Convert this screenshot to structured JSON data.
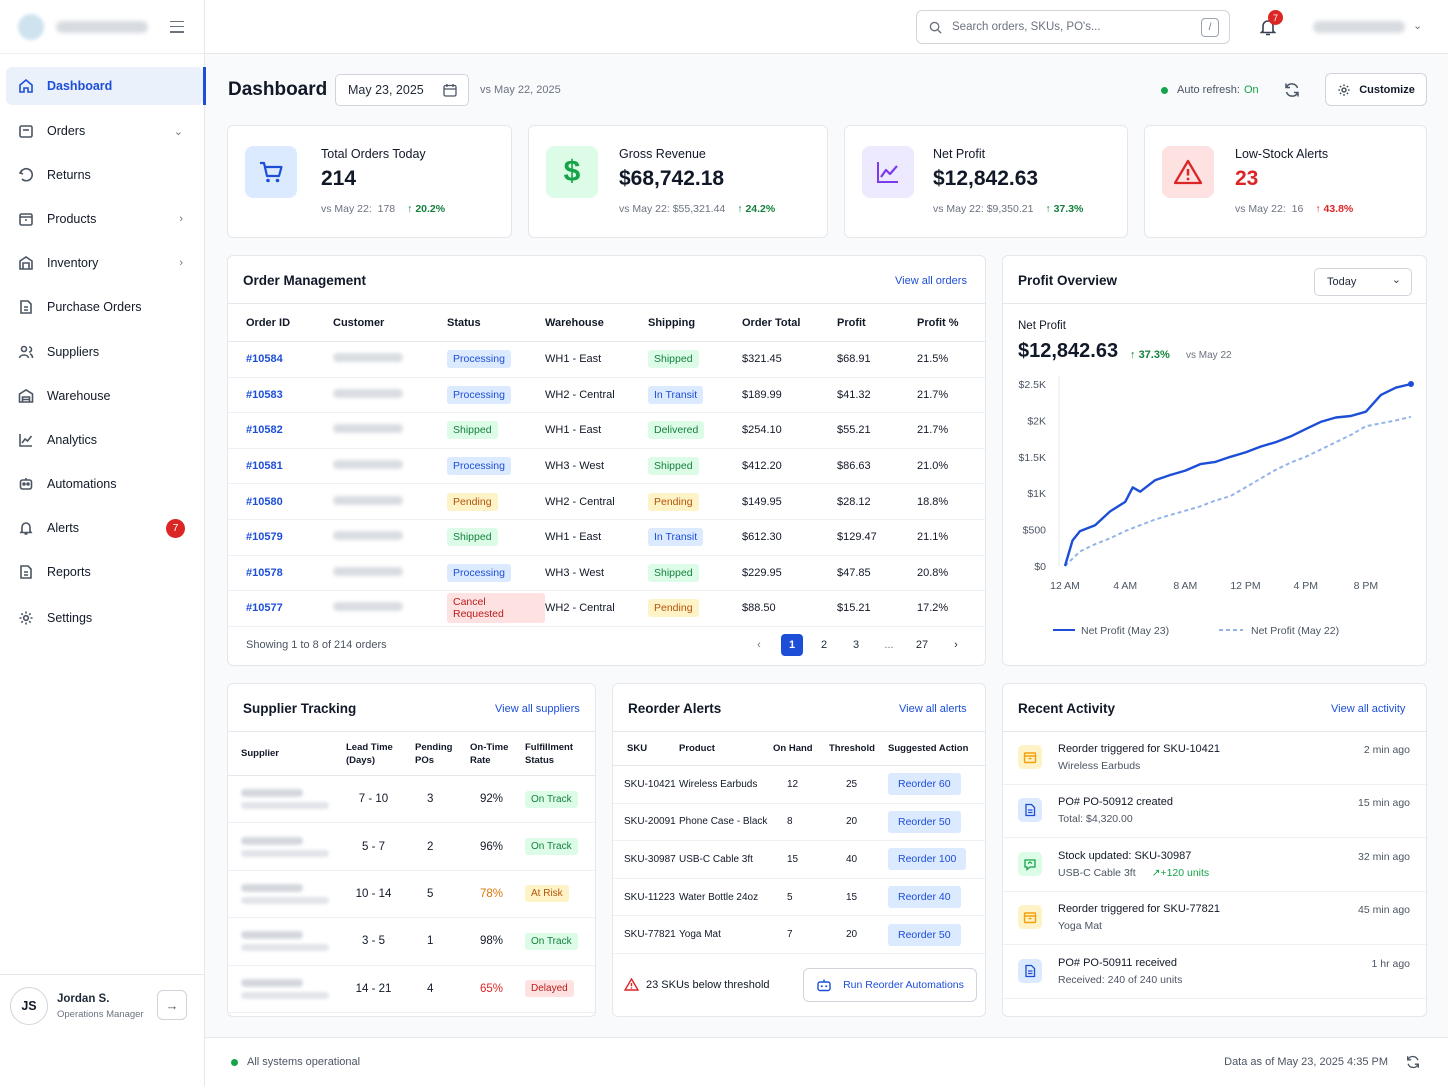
{
  "sidebar": {
    "items": [
      {
        "label": "Dashboard"
      },
      {
        "label": "Orders"
      },
      {
        "label": "Returns"
      },
      {
        "label": "Products"
      },
      {
        "label": "Inventory"
      },
      {
        "label": "Purchase Orders"
      },
      {
        "label": "Suppliers"
      },
      {
        "label": "Warehouse"
      },
      {
        "label": "Analytics"
      },
      {
        "label": "Automations"
      },
      {
        "label": "Alerts",
        "badge": "7"
      },
      {
        "label": "Reports"
      },
      {
        "label": "Settings"
      }
    ],
    "user": {
      "initials": "JS",
      "name": "Jordan S.",
      "role": "Operations Manager"
    }
  },
  "topbar": {
    "search_placeholder": "Search orders, SKUs, PO's...",
    "shortcut": "/",
    "notif_count": "7"
  },
  "header": {
    "title": "Dashboard",
    "date": "May 23, 2025",
    "compare": "vs May 22, 2025",
    "auto_refresh_label": "Auto refresh:",
    "auto_refresh_value": "On",
    "customize": "Customize"
  },
  "kpis": [
    {
      "label": "Total Orders Today",
      "value": "214",
      "prev_label": "vs May 22:",
      "prev": "178",
      "change": "20.2%"
    },
    {
      "label": "Gross Revenue",
      "value": "$68,742.18",
      "prev_label": "vs May 22:",
      "prev": "$55,321.44",
      "change": "24.2%"
    },
    {
      "label": "Net Profit",
      "value": "$12,842.63",
      "prev_label": "vs May 22:",
      "prev": "$9,350.21",
      "change": "37.3%"
    },
    {
      "label": "Low-Stock Alerts",
      "value": "23",
      "prev_label": "vs May 22:",
      "prev": "16",
      "change": "43.8%"
    }
  ],
  "orders": {
    "title": "Order Management",
    "link": "View all orders",
    "columns": [
      "Order ID",
      "Customer",
      "Status",
      "Warehouse",
      "Shipping",
      "Order Total",
      "Profit",
      "Profit %"
    ],
    "rows": [
      {
        "id": "#10584",
        "status": "Processing",
        "wh": "WH1 - East",
        "ship": "Shipped",
        "total": "$321.45",
        "profit": "$68.91",
        "pct": "21.5%"
      },
      {
        "id": "#10583",
        "status": "Processing",
        "wh": "WH2 - Central",
        "ship": "In Transit",
        "total": "$189.99",
        "profit": "$41.32",
        "pct": "21.7%"
      },
      {
        "id": "#10582",
        "status": "Shipped",
        "wh": "WH1 - East",
        "ship": "Delivered",
        "total": "$254.10",
        "profit": "$55.21",
        "pct": "21.7%"
      },
      {
        "id": "#10581",
        "status": "Processing",
        "wh": "WH3 - West",
        "ship": "Shipped",
        "total": "$412.20",
        "profit": "$86.63",
        "pct": "21.0%"
      },
      {
        "id": "#10580",
        "status": "Pending",
        "wh": "WH2 - Central",
        "ship": "Pending",
        "total": "$149.95",
        "profit": "$28.12",
        "pct": "18.8%"
      },
      {
        "id": "#10579",
        "status": "Shipped",
        "wh": "WH1 - East",
        "ship": "In Transit",
        "total": "$612.30",
        "profit": "$129.47",
        "pct": "21.1%"
      },
      {
        "id": "#10578",
        "status": "Processing",
        "wh": "WH3 - West",
        "ship": "Shipped",
        "total": "$229.95",
        "profit": "$47.85",
        "pct": "20.8%"
      },
      {
        "id": "#10577",
        "status": "Cancel Requested",
        "wh": "WH2 - Central",
        "ship": "Pending",
        "total": "$88.50",
        "profit": "$15.21",
        "pct": "17.2%"
      }
    ],
    "showing": "Showing 1 to 8 of 214 orders",
    "pages": [
      "1",
      "2",
      "3",
      "...",
      "27"
    ]
  },
  "profit_overview": {
    "title": "Profit Overview",
    "range": "Today",
    "metric": "Net Profit",
    "value": "$12,842.63",
    "change": "37.3%",
    "compare": "vs May 22"
  },
  "chart_data": {
    "type": "line",
    "x_ticks": [
      "12 AM",
      "4 AM",
      "8 AM",
      "12 PM",
      "4 PM",
      "8 PM"
    ],
    "y_ticks": [
      "$0",
      "$500",
      "$1K",
      "$1.5K",
      "$2K",
      "$2.5K"
    ],
    "ylim": [
      0,
      2500
    ],
    "xlim": [
      0,
      23
    ],
    "grid": false,
    "legend": "bottom",
    "series": [
      {
        "name": "Net Profit (May 23)",
        "color": "#1d4ed8",
        "style": "solid",
        "x": [
          0,
          0.5,
          1,
          2,
          3,
          4,
          4.5,
          5,
          6,
          7,
          8,
          9,
          10,
          11,
          12,
          13,
          14,
          15,
          16,
          17,
          18,
          19,
          20,
          21,
          22,
          23
        ],
        "y": [
          0,
          350,
          480,
          560,
          750,
          880,
          1080,
          1020,
          1180,
          1250,
          1310,
          1400,
          1430,
          1500,
          1560,
          1640,
          1700,
          1780,
          1880,
          1980,
          2040,
          2060,
          2120,
          2350,
          2450,
          2500
        ]
      },
      {
        "name": "Net Profit (May 22)",
        "color": "#93b4ea",
        "style": "dashed",
        "x": [
          0,
          1,
          2,
          3,
          4,
          5,
          6,
          7,
          8,
          9,
          10,
          11,
          12,
          13,
          14,
          15,
          16,
          17,
          18,
          19,
          20,
          21,
          22,
          23
        ],
        "y": [
          0,
          200,
          300,
          380,
          480,
          560,
          640,
          700,
          760,
          820,
          900,
          960,
          1080,
          1200,
          1320,
          1420,
          1500,
          1600,
          1700,
          1800,
          1920,
          1960,
          2000,
          2050
        ]
      }
    ]
  },
  "suppliers": {
    "title": "Supplier Tracking",
    "link": "View all suppliers",
    "columns": [
      "Supplier",
      "Lead Time (Days)",
      "Pending POs",
      "On-Time Rate",
      "Fulfillment Status"
    ],
    "rows": [
      {
        "lead": "7 - 10",
        "pos": "3",
        "rate": "92%",
        "status": "On Track",
        "rate_color": "#111827"
      },
      {
        "lead": "5 - 7",
        "pos": "2",
        "rate": "96%",
        "status": "On Track",
        "rate_color": "#111827"
      },
      {
        "lead": "10 - 14",
        "pos": "5",
        "rate": "78%",
        "status": "At Risk",
        "rate_color": "#d97706"
      },
      {
        "lead": "3 - 5",
        "pos": "1",
        "rate": "98%",
        "status": "On Track",
        "rate_color": "#111827"
      },
      {
        "lead": "14 - 21",
        "pos": "4",
        "rate": "65%",
        "status": "Delayed",
        "rate_color": "#dc2626"
      }
    ]
  },
  "reorder": {
    "title": "Reorder Alerts",
    "link": "View all alerts",
    "columns": [
      "SKU",
      "Product",
      "On Hand",
      "Threshold",
      "Suggested Action"
    ],
    "rows": [
      {
        "sku": "SKU-10421",
        "product": "Wireless Earbuds",
        "on_hand": "12",
        "threshold": "25",
        "action": "Reorder 60"
      },
      {
        "sku": "SKU-20091",
        "product": "Phone Case - Black",
        "on_hand": "8",
        "threshold": "20",
        "action": "Reorder 50"
      },
      {
        "sku": "SKU-30987",
        "product": "USB-C Cable 3ft",
        "on_hand": "15",
        "threshold": "40",
        "action": "Reorder 100"
      },
      {
        "sku": "SKU-11223",
        "product": "Water Bottle 24oz",
        "on_hand": "5",
        "threshold": "15",
        "action": "Reorder 40"
      },
      {
        "sku": "SKU-77821",
        "product": "Yoga Mat",
        "on_hand": "7",
        "threshold": "20",
        "action": "Reorder 50"
      }
    ],
    "below_threshold": "23 SKUs below threshold",
    "run_button": "Run Reorder Automations"
  },
  "activity": {
    "title": "Recent Activity",
    "link": "View all activity",
    "items": [
      {
        "title": "Reorder triggered for SKU-10421",
        "sub": "Wireless Earbuds",
        "time": "2 min ago",
        "icon": "box-icon",
        "color": "#f59e0b"
      },
      {
        "title": "PO# PO-50912 created",
        "sub": "Total: $4,320.00",
        "time": "15 min ago",
        "icon": "document-icon",
        "color": "#1d4ed8"
      },
      {
        "title": "Stock updated: SKU-30987",
        "sub": "USB-C Cable 3ft",
        "extra": "+120 units",
        "time": "32 min ago",
        "icon": "stock-icon",
        "color": "#16a34a"
      },
      {
        "title": "Reorder triggered for SKU-77821",
        "sub": "Yoga Mat",
        "time": "45 min ago",
        "icon": "box-icon",
        "color": "#f59e0b"
      },
      {
        "title": "PO# PO-50911 received",
        "sub": "Received: 240 of 240 units",
        "time": "1 hr ago",
        "icon": "document-icon",
        "color": "#1d4ed8"
      }
    ]
  },
  "status_bar": {
    "system": "All systems operational",
    "data_as_of": "Data as of May 23, 2025 4:35 PM"
  }
}
